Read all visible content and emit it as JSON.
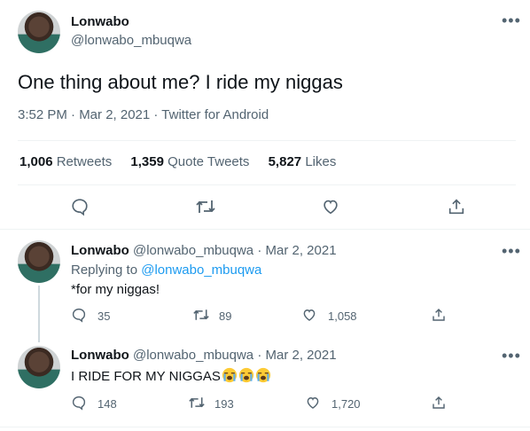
{
  "main_tweet": {
    "author_name": "Lonwabo",
    "author_handle": "@lonwabo_mbuqwa",
    "text": "One thing about me? I ride my niggas",
    "meta": "3:52 PM · Mar 2, 2021 · Twitter for Android",
    "stats": {
      "retweets_count": "1,006",
      "retweets_label": "Retweets",
      "quotes_count": "1,359",
      "quotes_label": "Quote Tweets",
      "likes_count": "5,827",
      "likes_label": "Likes"
    }
  },
  "replies": [
    {
      "author_name": "Lonwabo",
      "author_handle": "@lonwabo_mbuqwa",
      "date": "· Mar 2, 2021",
      "replying_prefix": "Replying to",
      "replying_to": "@lonwabo_mbuqwa",
      "text": "*for my niggas!",
      "reply_count": "35",
      "retweet_count": "89",
      "like_count": "1,058"
    },
    {
      "author_name": "Lonwabo",
      "author_handle": "@lonwabo_mbuqwa",
      "date": "· Mar 2, 2021",
      "text": "I RIDE FOR MY NIGGAS",
      "emojis": [
        "loudly-crying-face",
        "loudly-crying-face",
        "loudly-crying-face"
      ],
      "reply_count": "148",
      "retweet_count": "193",
      "like_count": "1,720"
    }
  ],
  "colors": {
    "text": "#0f1419",
    "muted": "#536471",
    "link": "#1d9bf0",
    "divider": "#eff3f4"
  }
}
